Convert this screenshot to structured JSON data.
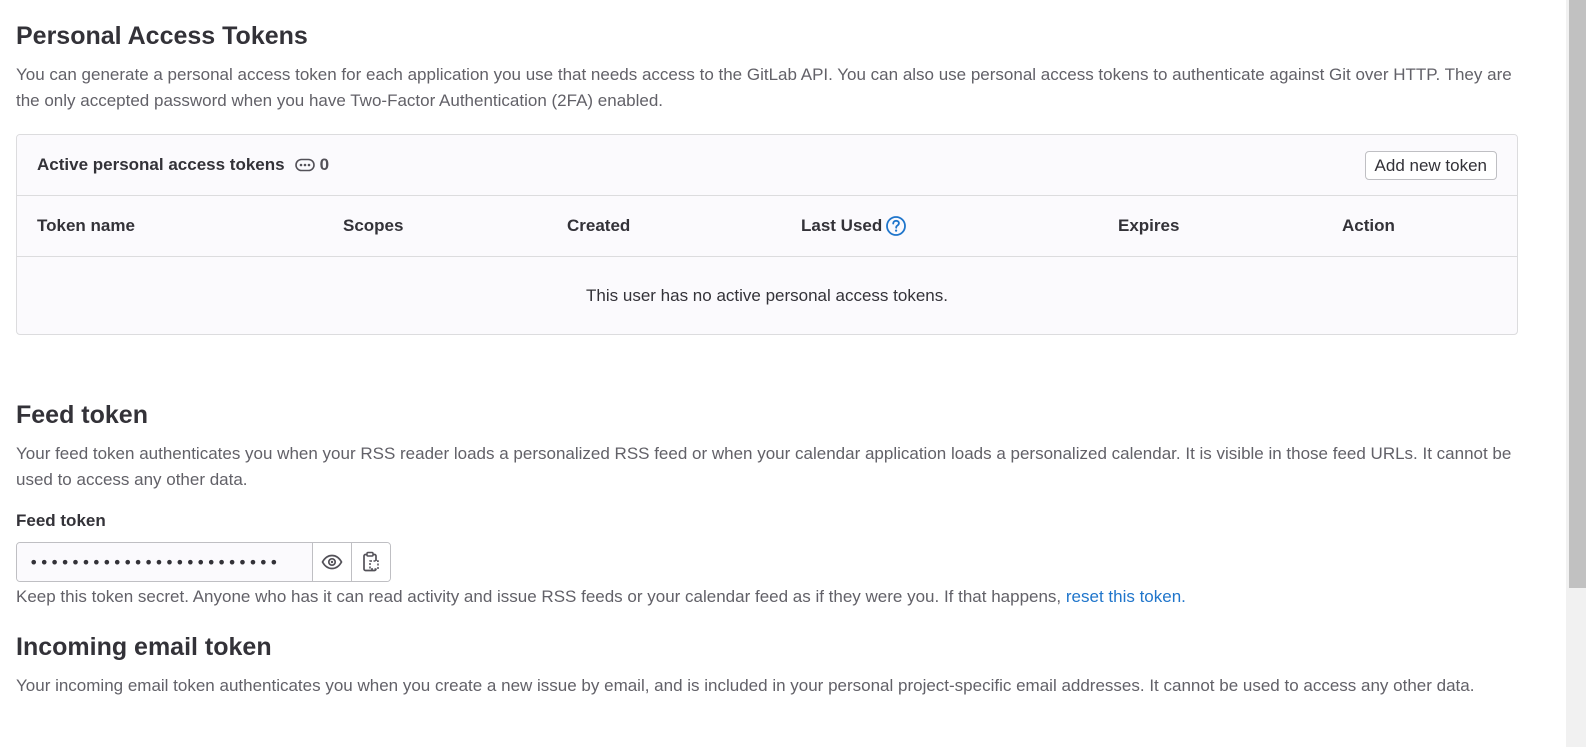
{
  "pat": {
    "title": "Personal Access Tokens",
    "description": "You can generate a personal access token for each application you use that needs access to the GitLab API. You can also use personal access tokens to authenticate against Git over HTTP. They are the only accepted password when you have Two-Factor Authentication (2FA) enabled.",
    "card_title": "Active personal access tokens",
    "count": "0",
    "add_button": "Add new token",
    "columns": [
      "Token name",
      "Scopes",
      "Created",
      "Last Used",
      "Expires",
      "Action"
    ],
    "empty_text": "This user has no active personal access tokens."
  },
  "feed": {
    "title": "Feed token",
    "description": "Your feed token authenticates you when your RSS reader loads a personalized RSS feed or when your calendar application loads a personalized calendar. It is visible in those feed URLs. It cannot be used to access any other data.",
    "label": "Feed token",
    "masked_value": "••••••••••••••••••••••••",
    "help_text": "Keep this token secret. Anyone who has it can read activity and issue RSS feeds or your calendar feed as if they were you. If that happens, ",
    "reset_link": "reset this token."
  },
  "email": {
    "title": "Incoming email token",
    "description": "Your incoming email token authenticates you when you create a new issue by email, and is included in your personal project-specific email addresses. It cannot be used to access any other data."
  },
  "colors": {
    "link": "#1f75cb",
    "text": "#333238",
    "muted": "#626168",
    "border": "#dcdcde"
  },
  "icons": {
    "count": "token-icon",
    "help": "question-icon",
    "reveal": "eye-icon",
    "copy": "clipboard-icon"
  }
}
